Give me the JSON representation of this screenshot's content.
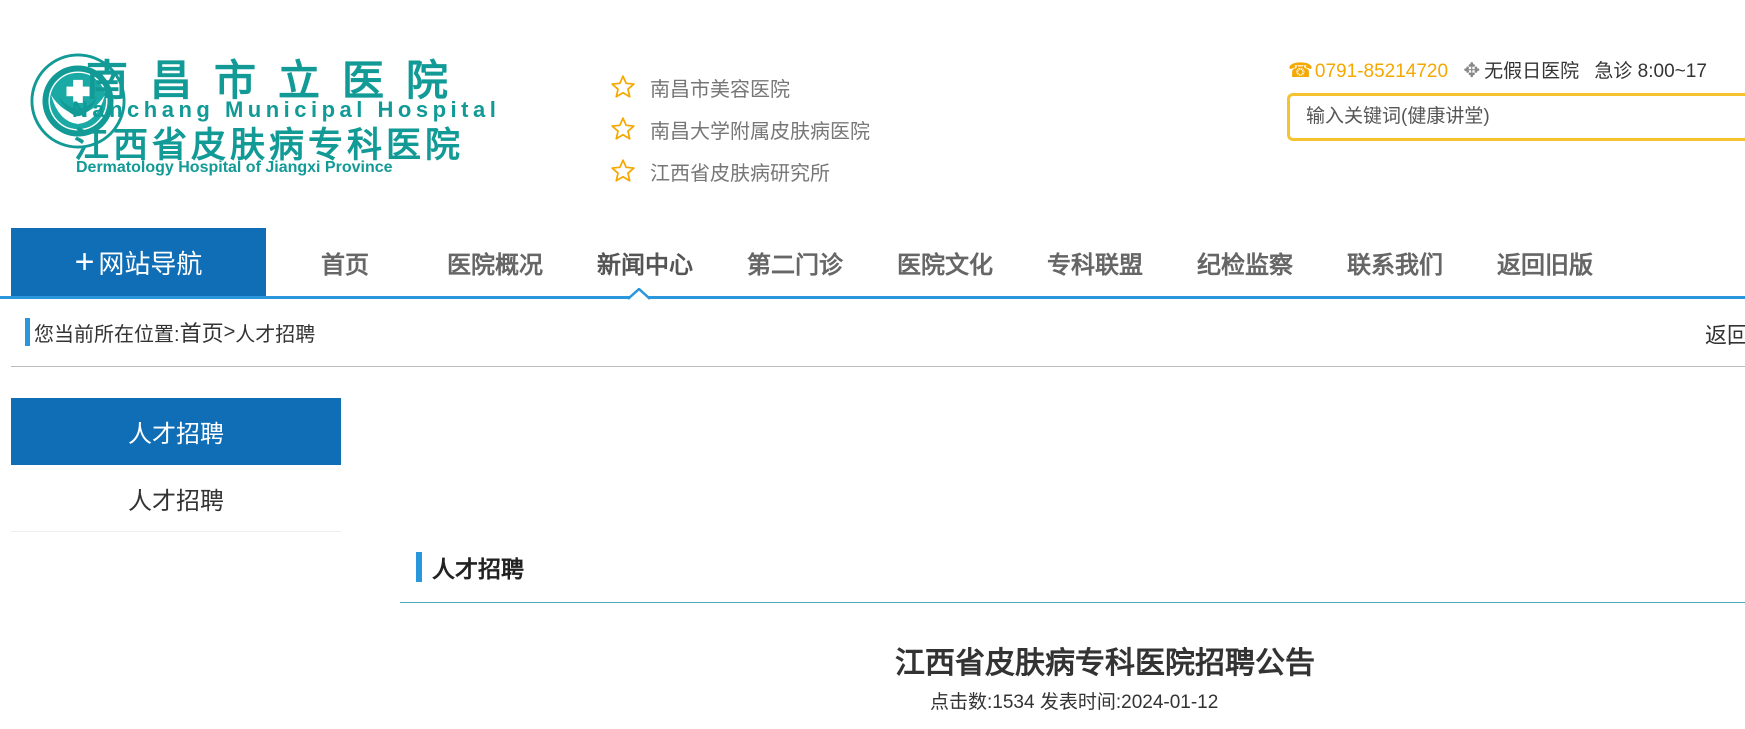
{
  "logo": {
    "cn_name": "南昌市立医院",
    "en_name": "Nanchang Municipal Hospital",
    "cn_name2": "江西省皮肤病专科医院",
    "en_name2": "Dermatology Hospital of Jiangxi Province"
  },
  "affiliations": [
    "南昌市美容医院",
    "南昌大学附属皮肤病医院",
    "江西省皮肤病研究所"
  ],
  "contact": {
    "phone": "0791-85214720",
    "holiday": "无假日医院",
    "emergency": "急诊 8:00~17"
  },
  "search": {
    "placeholder": "输入关键词(健康讲堂)"
  },
  "nav": {
    "site_nav_label": "网站导航",
    "items": [
      "首页",
      "医院概况",
      "新闻中心",
      "第二门诊",
      "医院文化",
      "专科联盟",
      "纪检监察",
      "联系我们",
      "返回旧版"
    ]
  },
  "breadcrumb": {
    "prefix": "您当前所在位置:",
    "home": "首页",
    "sep": " > ",
    "current": "人才招聘",
    "back": "返回"
  },
  "sidebar": {
    "title": "人才招聘",
    "items": [
      "人才招聘"
    ]
  },
  "content": {
    "section_title": "人才招聘",
    "article_title": "江西省皮肤病专科医院招聘公告",
    "clicks_label": "点击数:",
    "clicks": "1534",
    "date_label": "发表时间:",
    "date": "2024-01-12"
  },
  "colors": {
    "teal": "#129a96",
    "blue": "#0f6eb5",
    "accent": "#f5a800"
  }
}
